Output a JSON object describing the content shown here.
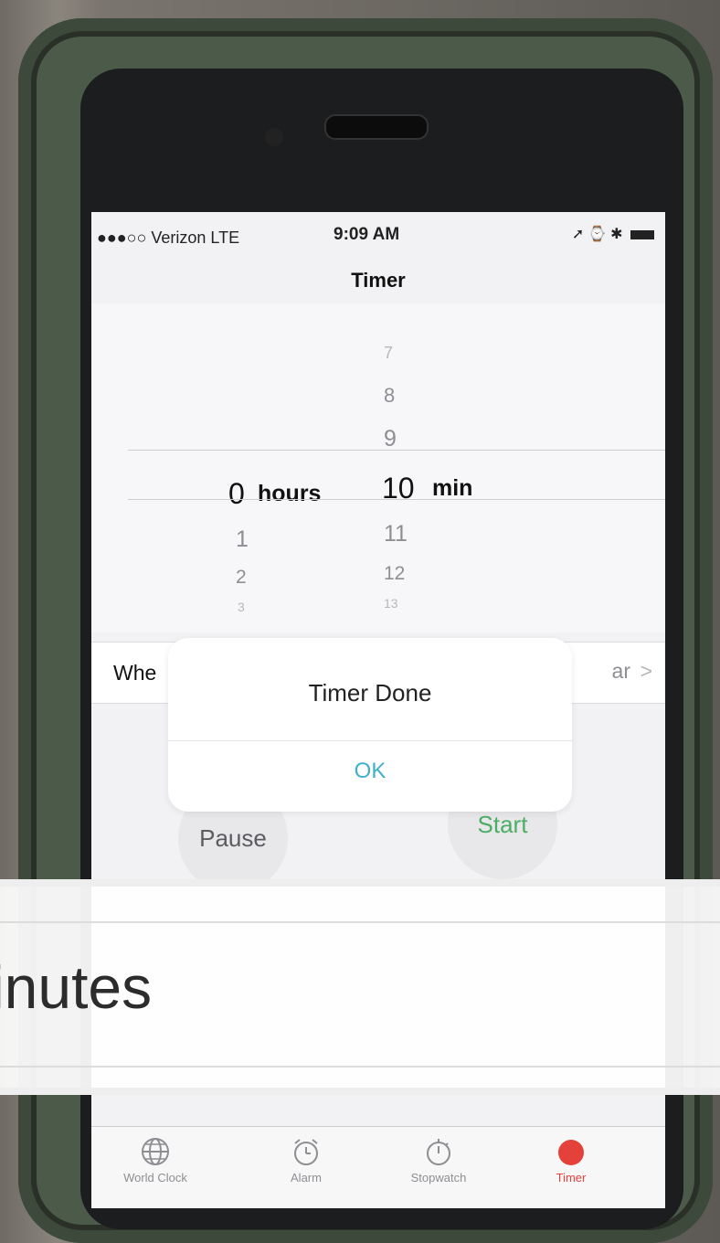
{
  "status": {
    "carrier": "●●●○○ Verizon  LTE",
    "time": "9:09 AM",
    "icons": "➚ ⌚ ✱"
  },
  "nav": {
    "title": "Timer"
  },
  "picker": {
    "hours_selected": "0",
    "hours_unit": "hours",
    "hours_below": [
      "1",
      "2",
      "3"
    ],
    "minutes_above": [
      "7",
      "8",
      "9"
    ],
    "minutes_selected": "10",
    "minutes_unit": "min",
    "minutes_below": [
      "11",
      "12",
      "13"
    ]
  },
  "when_row": {
    "label": "Whe",
    "value": "ar",
    "chevron": ">"
  },
  "buttons": {
    "pause": "Pause",
    "start": "Start"
  },
  "alert": {
    "title": "Timer Done",
    "ok": "OK"
  },
  "tabs": [
    {
      "label": "World Clock",
      "icon": "globe-icon"
    },
    {
      "label": "Alarm",
      "icon": "alarm-clock-icon"
    },
    {
      "label": "Stopwatch",
      "icon": "stopwatch-icon"
    },
    {
      "label": "Timer",
      "icon": "timer-icon",
      "active": true
    }
  ],
  "caption": {
    "text": "inutes"
  },
  "colors": {
    "accent_red": "#e5413b",
    "start_green": "#4cae64",
    "ok_blue": "#3fb0c9"
  }
}
